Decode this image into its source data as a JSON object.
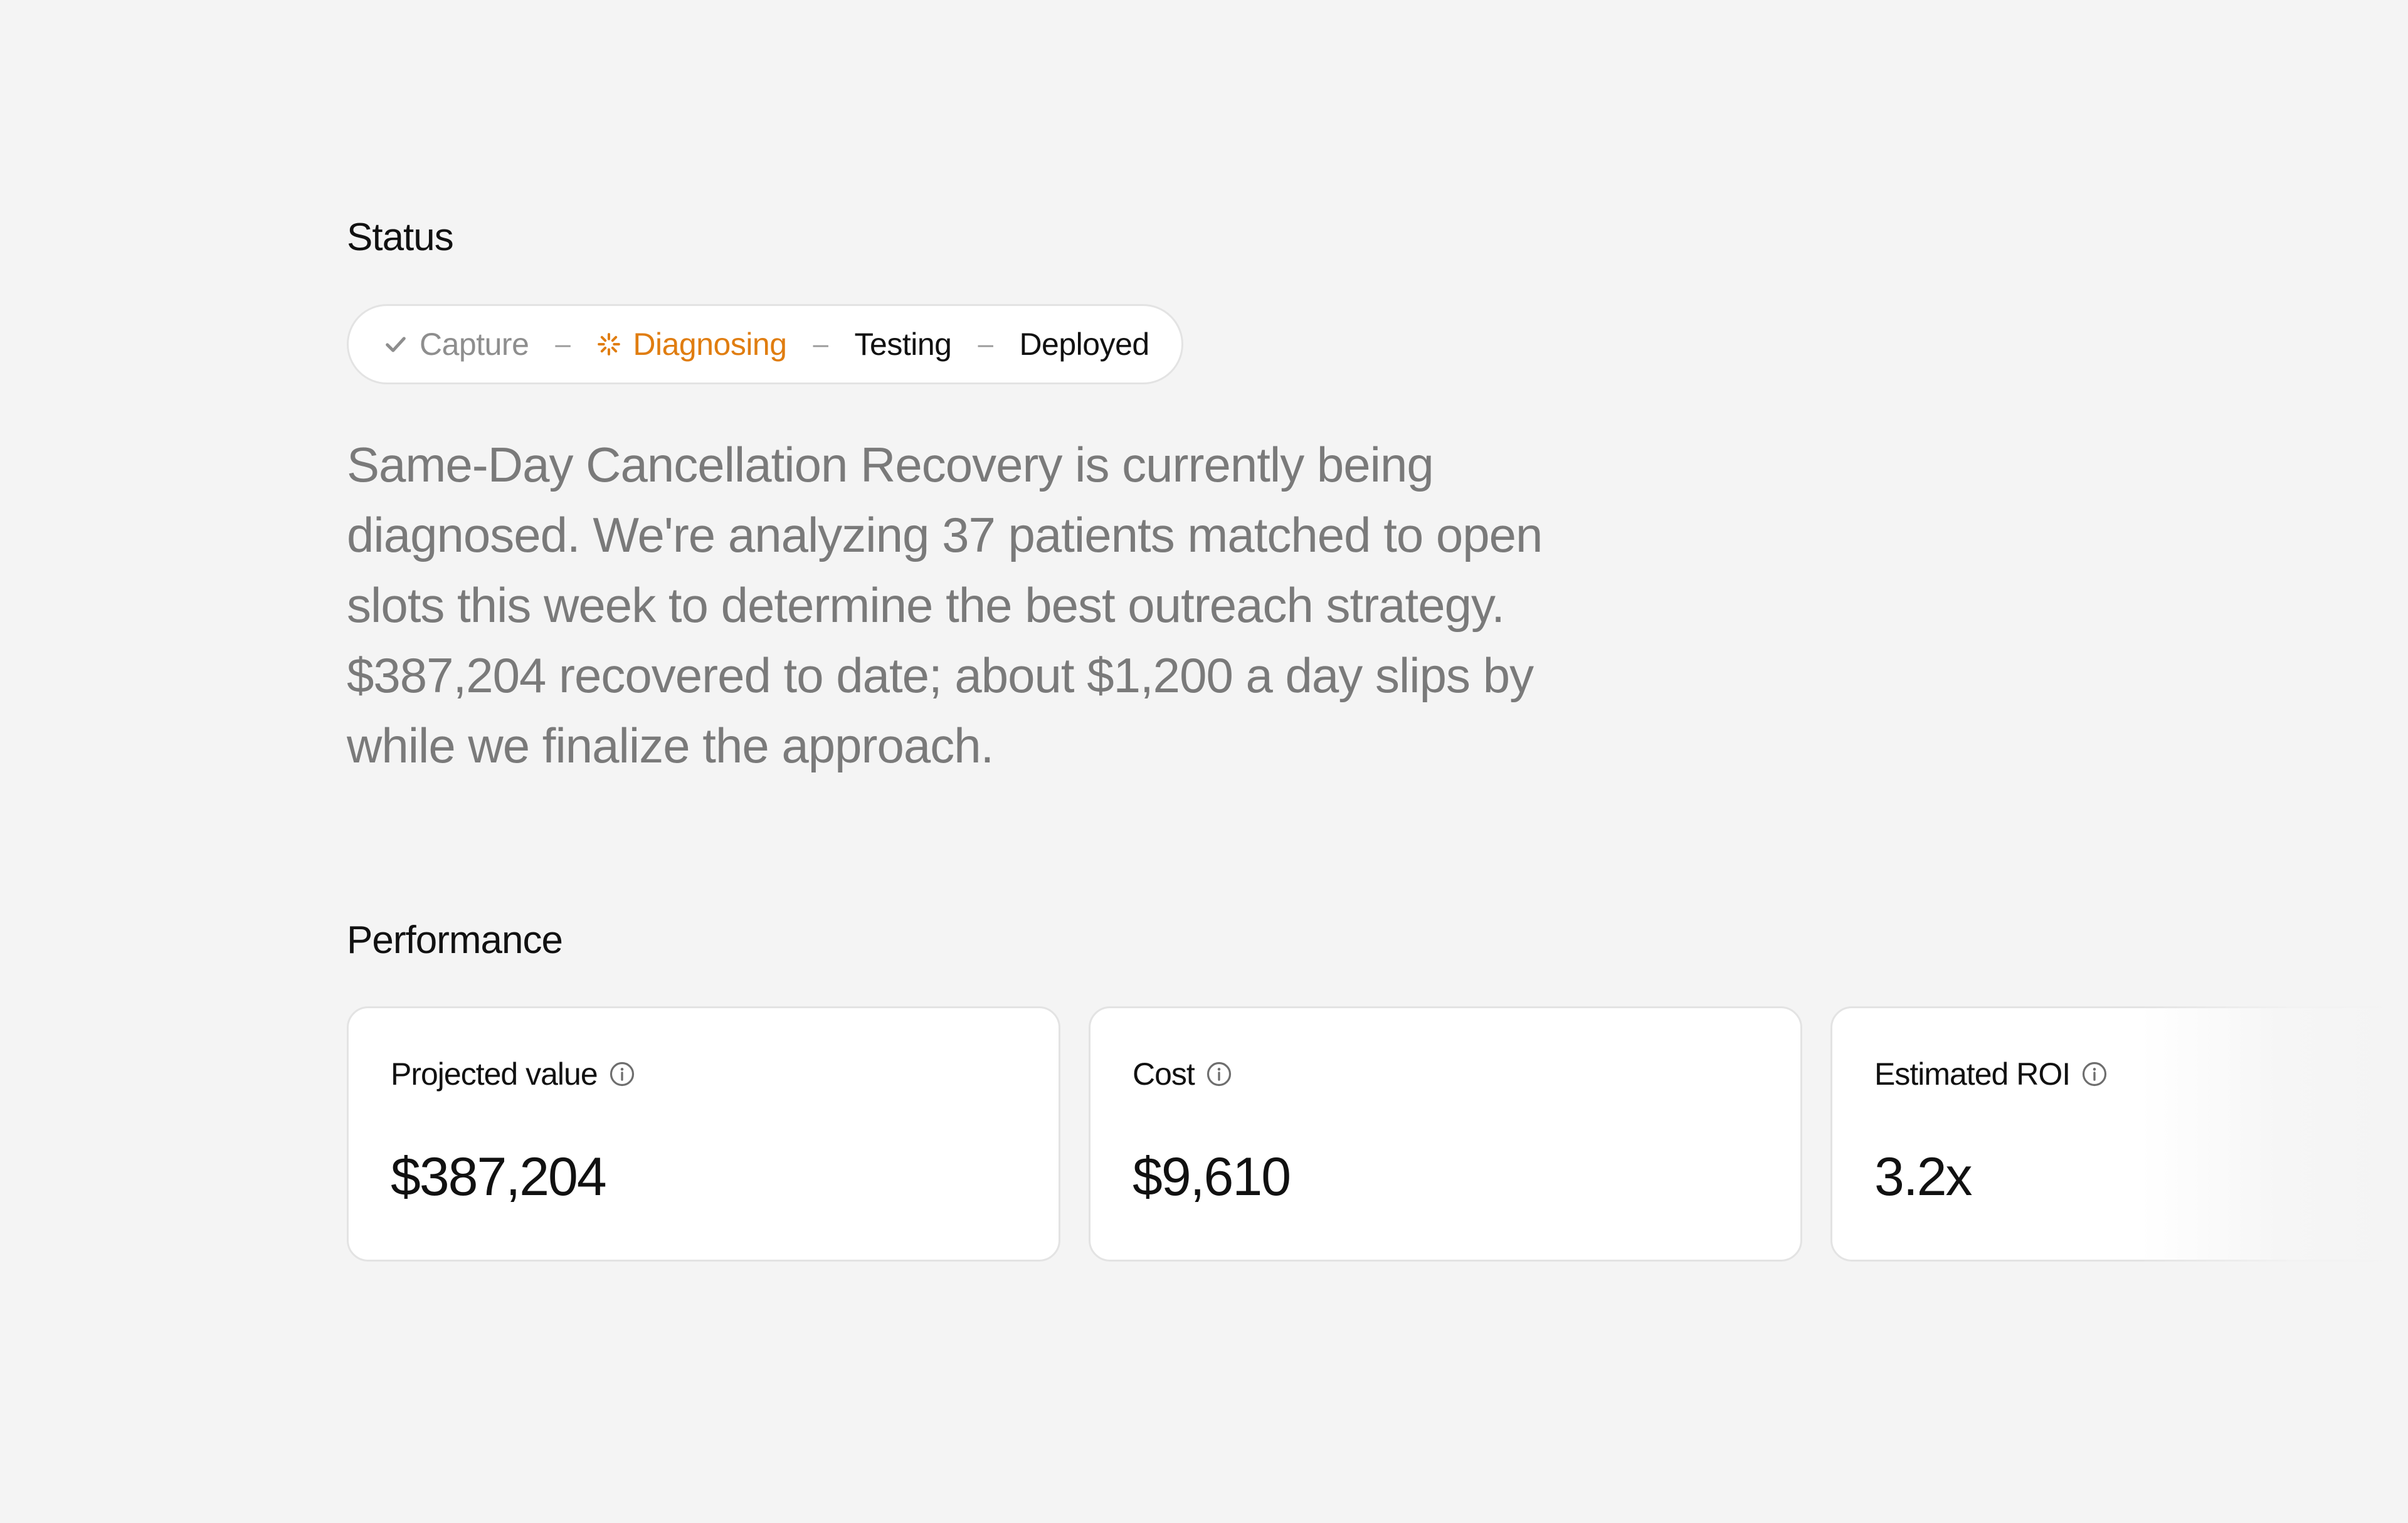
{
  "status": {
    "title": "Status",
    "steps": [
      {
        "label": "Capture",
        "state": "done",
        "icon": "check-icon"
      },
      {
        "label": "Diagnosing",
        "state": "active",
        "icon": "spinner-icon"
      },
      {
        "label": "Testing",
        "state": "pending"
      },
      {
        "label": "Deployed",
        "state": "pending"
      }
    ],
    "separator": "–",
    "description": "Same-Day Cancellation Recovery is currently being diagnosed. We're analyzing 37 patients matched to open slots this week to determine the best outreach strategy. $387,204 recovered to date; about $1,200 a day slips by while we finalize the approach."
  },
  "performance": {
    "title": "Performance",
    "cards": [
      {
        "label": "Projected value",
        "value": "$387,204",
        "icon": "info-icon"
      },
      {
        "label": "Cost",
        "value": "$9,610",
        "icon": "info-icon"
      },
      {
        "label": "Estimated ROI",
        "value": "3.2x",
        "icon": "info-icon"
      }
    ]
  },
  "colors": {
    "background": "#f4f4f4",
    "active_step": "#e07d10",
    "done_step": "#8e8e8e",
    "muted_text": "#7a7a7a",
    "card_border": "#e3e3e3"
  }
}
